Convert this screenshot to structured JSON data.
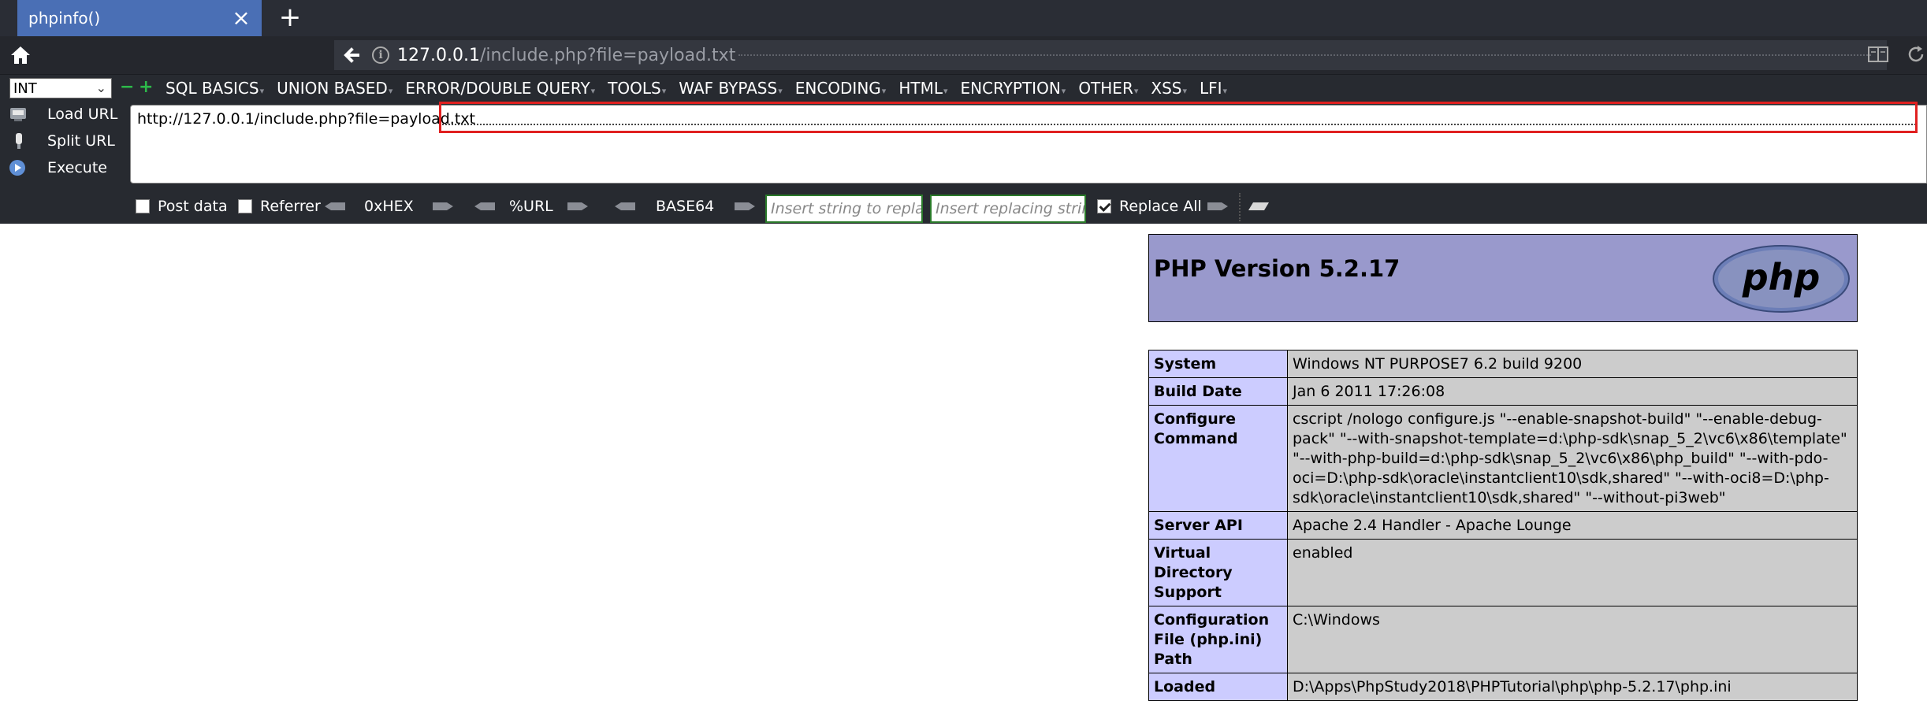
{
  "browser": {
    "tab_title": "phpinfo()",
    "url_host": "127.0.0.1",
    "url_path": "/include.php?file=payload.txt"
  },
  "hackbar": {
    "type_select": "INT",
    "menus": [
      "SQL BASICS",
      "UNION BASED",
      "ERROR/DOUBLE QUERY",
      "TOOLS",
      "WAF BYPASS",
      "ENCODING",
      "HTML",
      "ENCRYPTION",
      "OTHER",
      "XSS",
      "LFI"
    ],
    "load_url": "Load URL",
    "split_url": "Split URL",
    "execute": "Execute",
    "url_text": "http://127.0.0.1/include.php?file=payload.txt",
    "post_data": "Post data",
    "referrer": "Referrer",
    "hex": "0xHEX",
    "url_enc": "%URL",
    "base64": "BASE64",
    "replace_placeholder": "Insert string to replace",
    "replacing_placeholder": "Insert replacing string",
    "replace_all": "Replace All",
    "replace_all_checked": true,
    "post_data_checked": false,
    "referrer_checked": false
  },
  "page": {
    "title": "PHP Version 5.2.17",
    "logo_text": "php",
    "rows": [
      {
        "label": "System",
        "value": "Windows NT PURPOSE7 6.2 build 9200"
      },
      {
        "label": "Build Date",
        "value": "Jan 6 2011 17:26:08"
      },
      {
        "label": "Configure Command",
        "value": "cscript /nologo configure.js \"--enable-snapshot-build\" \"--enable-debug-pack\" \"--with-snapshot-template=d:\\php-sdk\\snap_5_2\\vc6\\x86\\template\" \"--with-php-build=d:\\php-sdk\\snap_5_2\\vc6\\x86\\php_build\" \"--with-pdo-oci=D:\\php-sdk\\oracle\\instantclient10\\sdk,shared\" \"--with-oci8=D:\\php-sdk\\oracle\\instantclient10\\sdk,shared\" \"--without-pi3web\""
      },
      {
        "label": "Server API",
        "value": "Apache 2.4 Handler - Apache Lounge"
      },
      {
        "label": "Virtual Directory Support",
        "value": "enabled"
      },
      {
        "label": "Configuration File (php.ini) Path",
        "value": "C:\\Windows"
      },
      {
        "label": "Loaded",
        "value": "D:\\Apps\\PhpStudy2018\\PHPTutorial\\php\\php-5.2.17\\php.ini"
      }
    ]
  }
}
